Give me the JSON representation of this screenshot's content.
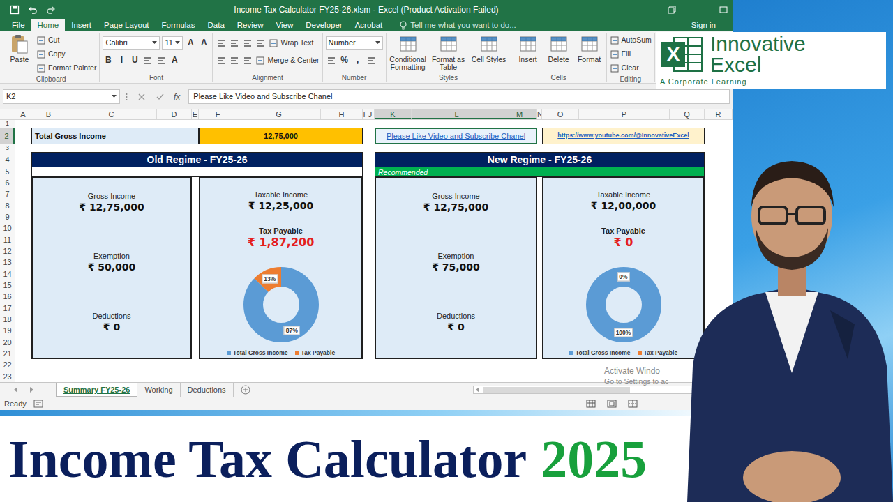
{
  "window": {
    "title": "Income Tax Calculator FY25-26.xlsm - Excel (Product Activation Failed)"
  },
  "ribbon_tabs": [
    {
      "label": "File",
      "selected": false
    },
    {
      "label": "Home",
      "selected": true
    },
    {
      "label": "Insert",
      "selected": false
    },
    {
      "label": "Page Layout",
      "selected": false
    },
    {
      "label": "Formulas",
      "selected": false
    },
    {
      "label": "Data",
      "selected": false
    },
    {
      "label": "Review",
      "selected": false
    },
    {
      "label": "View",
      "selected": false
    },
    {
      "label": "Developer",
      "selected": false
    },
    {
      "label": "Acrobat",
      "selected": false
    }
  ],
  "tell_me": "Tell me what you want to do...",
  "sign_in": "Sign in",
  "ribbon_groups": [
    {
      "name": "Clipboard",
      "large": [
        "Paste"
      ],
      "rows": [
        [
          {
            "kind": "small",
            "label": "Cut"
          }
        ],
        [
          {
            "kind": "small",
            "label": "Copy"
          }
        ],
        [
          {
            "kind": "small",
            "label": "Format Painter"
          }
        ]
      ]
    },
    {
      "name": "Font",
      "large": [],
      "rows": [
        [
          {
            "kind": "combo",
            "label": "Calibri"
          },
          {
            "kind": "combo",
            "label": "11"
          },
          {
            "kind": "glyph",
            "label": "A"
          },
          {
            "kind": "glyph",
            "label": "A"
          }
        ],
        [
          {
            "kind": "glyph",
            "label": "B"
          },
          {
            "kind": "glyph",
            "label": "I"
          },
          {
            "kind": "glyph",
            "label": "U"
          },
          {
            "kind": "icon"
          },
          {
            "kind": "icon"
          },
          {
            "kind": "glyph",
            "label": "A"
          }
        ]
      ]
    },
    {
      "name": "Alignment",
      "large": [],
      "rows": [
        [
          {
            "kind": "icon"
          },
          {
            "kind": "icon"
          },
          {
            "kind": "icon"
          },
          {
            "kind": "icon"
          },
          {
            "kind": "small",
            "label": "Wrap Text"
          }
        ],
        [
          {
            "kind": "icon"
          },
          {
            "kind": "icon"
          },
          {
            "kind": "icon"
          },
          {
            "kind": "small",
            "label": "Merge & Center"
          }
        ]
      ]
    },
    {
      "name": "Number",
      "large": [],
      "rows": [
        [
          {
            "kind": "combo",
            "label": "Number"
          }
        ],
        [
          {
            "kind": "icon"
          },
          {
            "kind": "glyph",
            "label": "%"
          },
          {
            "kind": "glyph",
            "label": ","
          },
          {
            "kind": "icon"
          }
        ]
      ]
    },
    {
      "name": "Styles",
      "large": [
        "Conditional Formatting",
        "Format as Table",
        "Cell Styles"
      ]
    },
    {
      "name": "Cells",
      "large": [
        "Insert",
        "Delete",
        "Format"
      ]
    },
    {
      "name": "Editing",
      "large": [],
      "rows": [
        [
          {
            "kind": "small",
            "label": "AutoSum"
          }
        ],
        [
          {
            "kind": "small",
            "label": "Fill"
          }
        ],
        [
          {
            "kind": "small",
            "label": "Clear"
          }
        ]
      ]
    }
  ],
  "name_box": "K2",
  "formula_bar": {
    "fx": "fx",
    "content": "Please Like Video and Subscribe Chanel"
  },
  "columns": [
    {
      "label": "A",
      "selected": false
    },
    {
      "label": "B",
      "selected": false
    },
    {
      "label": "C",
      "selected": false
    },
    {
      "label": "D",
      "selected": false
    },
    {
      "label": "E",
      "selected": false
    },
    {
      "label": "F",
      "selected": false
    },
    {
      "label": "G",
      "selected": false
    },
    {
      "label": "H",
      "selected": false
    },
    {
      "label": "I",
      "selected": false
    },
    {
      "label": "J",
      "selected": false
    },
    {
      "label": "K",
      "selected": true
    },
    {
      "label": "L",
      "selected": true
    },
    {
      "label": "M",
      "selected": true
    },
    {
      "label": "N",
      "selected": false
    },
    {
      "label": "O",
      "selected": false
    },
    {
      "label": "P",
      "selected": false
    },
    {
      "label": "Q",
      "selected": false
    },
    {
      "label": "R",
      "selected": false
    }
  ],
  "rows": [
    {
      "label": "1",
      "selected": false
    },
    {
      "label": "2",
      "selected": true
    },
    {
      "label": "3",
      "selected": false
    },
    {
      "label": "4",
      "selected": false
    },
    {
      "label": "5",
      "selected": false
    },
    {
      "label": "6",
      "selected": false
    },
    {
      "label": "7",
      "selected": false
    },
    {
      "label": "8",
      "selected": false
    },
    {
      "label": "9",
      "selected": false
    },
    {
      "label": "10",
      "selected": false
    },
    {
      "label": "11",
      "selected": false
    },
    {
      "label": "12",
      "selected": false
    },
    {
      "label": "13",
      "selected": false
    },
    {
      "label": "14",
      "selected": false
    },
    {
      "label": "15",
      "selected": false
    },
    {
      "label": "16",
      "selected": false
    },
    {
      "label": "17",
      "selected": false
    },
    {
      "label": "18",
      "selected": false
    },
    {
      "label": "19",
      "selected": false
    },
    {
      "label": "20",
      "selected": false
    },
    {
      "label": "21",
      "selected": false
    },
    {
      "label": "22",
      "selected": false
    },
    {
      "label": "23",
      "selected": false
    }
  ],
  "summary": {
    "label": "Total Gross Income",
    "value": "12,75,000"
  },
  "promo": {
    "link": "Please Like Video and Subscribe Chanel",
    "link_selected": true,
    "url": "https://www.youtube.com/@InnovativeExcel"
  },
  "regimes": [
    {
      "title": "Old Regime - FY25-26",
      "recommended": false,
      "left": [
        {
          "label": "Gross Income",
          "value": "₹ 12,75,000"
        },
        {
          "label": "Exemption",
          "value": "₹ 50,000"
        },
        {
          "label": "Deductions",
          "value": "₹ 0"
        }
      ],
      "taxable": {
        "label": "Taxable Income",
        "value": "₹ 12,25,000"
      },
      "tax": {
        "label": "Tax Payable",
        "value": "₹ 1,87,200"
      },
      "chart": {
        "slices": [
          {
            "name": "Total Gross Income",
            "value": 1275000,
            "label": "87%",
            "color": "#5b9bd5"
          },
          {
            "name": "Tax Payable",
            "value": 187200,
            "label": "13%",
            "color": "#ed7d31"
          }
        ]
      }
    },
    {
      "title": "New Regime - FY25-26",
      "recommended": true,
      "banner": "Recommended",
      "left": [
        {
          "label": "Gross Income",
          "value": "₹ 12,75,000"
        },
        {
          "label": "Exemption",
          "value": "₹ 75,000"
        },
        {
          "label": "Deductions",
          "value": "₹ 0"
        }
      ],
      "taxable": {
        "label": "Taxable Income",
        "value": "₹ 12,00,000"
      },
      "tax": {
        "label": "Tax Payable",
        "value": "₹ 0"
      },
      "chart": {
        "slices": [
          {
            "name": "Total Gross Income",
            "value": 1275000,
            "label": "100%",
            "color": "#5b9bd5"
          },
          {
            "name": "Tax Payable",
            "value": 0,
            "label": "0%",
            "color": "#ed7d31"
          }
        ]
      }
    }
  ],
  "sheet_tabs": [
    {
      "label": "Summary FY25-26",
      "selected": true
    },
    {
      "label": "Working",
      "selected": false
    },
    {
      "label": "Deductions",
      "selected": false
    }
  ],
  "status": "Ready",
  "watermark": [
    "Activate Windo",
    "Go to Settings to ac"
  ],
  "logo": {
    "letter": "X",
    "line1": "Innovative",
    "line2": "Excel",
    "tagline": "A Corporate Learning"
  },
  "banner": {
    "text": "Income Tax Calculator",
    "year": "2025"
  }
}
